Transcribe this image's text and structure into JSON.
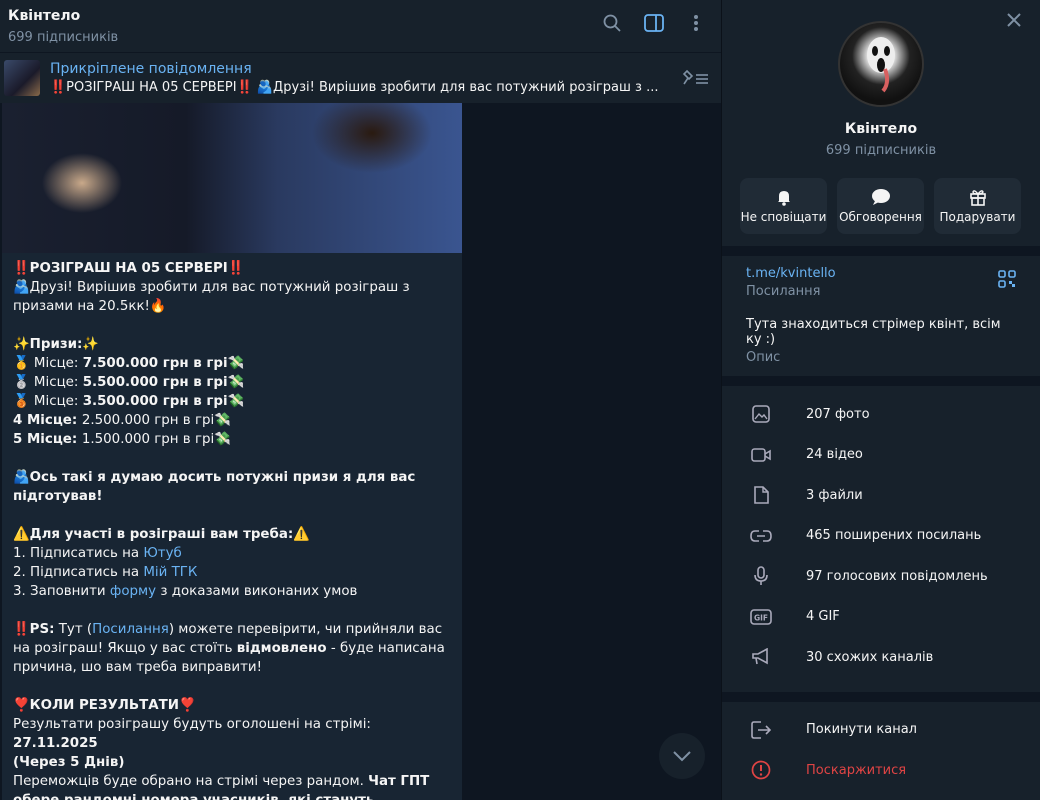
{
  "chat": {
    "title": "Квінтело",
    "subtitle": "699 підписників"
  },
  "pinned": {
    "label": "Прикріплене повідомлення",
    "text": "‼️РОЗІГРАШ НА 05 СЕРВЕРІ‼️ 🫂Друзі! Вирішив зробити для вас потужний розіграш з ..."
  },
  "message": {
    "l1": "‼️РОЗІГРАШ НА 05 СЕРВЕРІ‼️",
    "l2": "🫂Друзі! Вирішив зробити для вас потужний розіграш з призами на 20.5кк!🔥",
    "prizes_title": "✨Призи:✨",
    "p1_pre": "🥇 Місце: ",
    "p1_bold": "7.500.000 грн в грі",
    "p2_pre": "🥈 Місце: ",
    "p2_bold": "5.500.000 грн в грі",
    "p3_pre": "🥉 Місце: ",
    "p3_bold": "3.500.000 грн в грі",
    "money": "💸",
    "p4_bold": "4 Місце: ",
    "p4_rest": "2.500.000 грн в грі💸",
    "p5_bold": "5 Місце: ",
    "p5_rest": "1.500.000 грн в грі💸",
    "think": "🫂Ось такі я думаю досить потужні призи я для вас підготував!",
    "req_title": "⚠️Для участі в розіграші вам треба:⚠️",
    "r1_pre": "1. Підписатись на ",
    "r1_link": "Ютуб",
    "r2_pre": "2. Підписатись на ",
    "r2_link": "Мій ТГК",
    "r3_pre": "3. Заповнити ",
    "r3_link": "форму",
    "r3_post": " з доказами виконаних умов",
    "ps_bold": "‼️PS:",
    "ps_a": " Тут (",
    "ps_link": "Посилання",
    "ps_b": ") можете перевірити, чи прийняли вас на розіграш! Якщо у вас стоїть ",
    "ps_bold2": "відмовлено",
    "ps_c": " - буде написана причина, шо вам треба виправити!",
    "res_title": "❣️КОЛИ РЕЗУЛЬТАТИ❣️",
    "res_a": "Результати розіграшу будуть оголошені на стрімі: ",
    "res_date": "27.11.2025",
    "res_days": "(Через 5 Днів)",
    "win_a": "Переможців буде обрано на стрімі через рандом. ",
    "win_b": "Чат ГПТ обере рандомні номера учасників, які стануть переможцями."
  },
  "panel": {
    "name": "Квінтело",
    "subtitle": "699 підписників",
    "actions": [
      "Не сповіщати",
      "Обговорення",
      "Подарувати"
    ],
    "link": "t.me/kvintello",
    "link_label": "Посилання",
    "description": "Тута знаходиться стрімер квінт, всім ку :)",
    "description_label": "Опис",
    "media": [
      "207 фото",
      "24 відео",
      "3 файли",
      "465 поширених посилань",
      "97 голосових повідомлень",
      "4 GIF",
      "30 схожих каналів"
    ],
    "leave": "Покинути канал",
    "report": "Поскаржитися"
  },
  "colors": {
    "accent": "#6ab3f3",
    "danger": "#e04444",
    "bg": "#0e1621",
    "panel": "#17212b"
  }
}
